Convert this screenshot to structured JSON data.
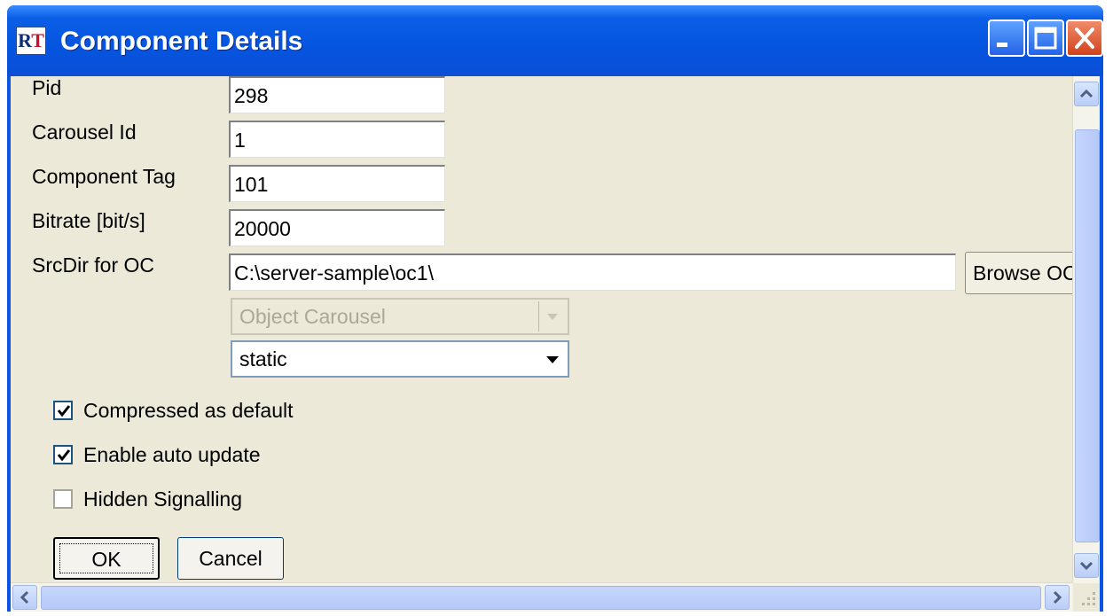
{
  "window": {
    "title": "Component Details",
    "icon": "app-logo-icon",
    "icon_text": "RT"
  },
  "fields": {
    "pid": {
      "label": "Pid",
      "value": "298"
    },
    "carousel_id": {
      "label": "Carousel Id",
      "value": "1"
    },
    "component_tag": {
      "label": "Component Tag",
      "value": "101"
    },
    "bitrate": {
      "label": "Bitrate [bit/s]",
      "value": "20000"
    },
    "srcdir": {
      "label": "SrcDir for OC",
      "value": "C:\\server-sample\\oc1\\"
    }
  },
  "browse_button": "Browse OC D",
  "combos": {
    "carousel_type": {
      "value": "Object Carousel",
      "disabled": true
    },
    "mode": {
      "value": "static"
    }
  },
  "checkboxes": [
    {
      "label": "Compressed as default",
      "checked": true
    },
    {
      "label": "Enable auto update",
      "checked": true
    },
    {
      "label": "Hidden Signalling",
      "checked": false
    }
  ],
  "buttons": {
    "ok": "OK",
    "cancel": "Cancel"
  },
  "colors": {
    "titlebar": "#0555e0",
    "client_bg": "#ece9d8",
    "disabled_text": "#aca899"
  }
}
